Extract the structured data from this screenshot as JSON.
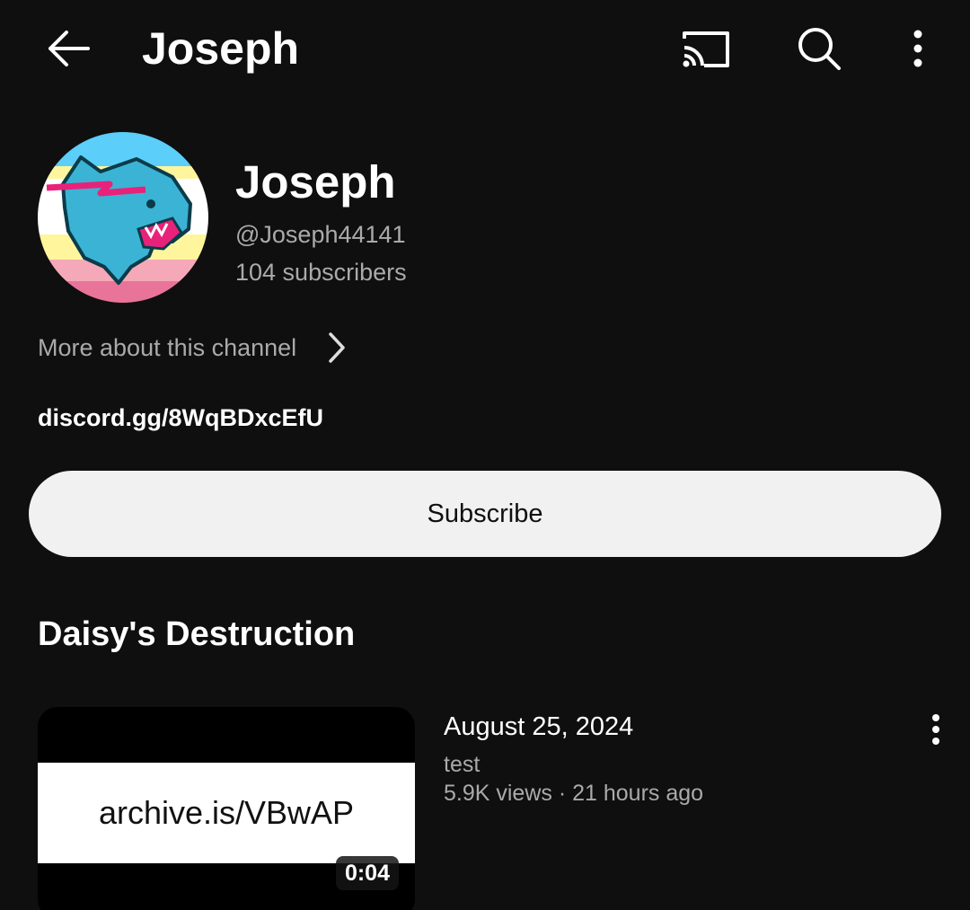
{
  "topbar": {
    "title": "Joseph",
    "icons": [
      "back-arrow-icon",
      "cast-icon",
      "search-icon",
      "more-vert-icon"
    ]
  },
  "channel": {
    "name": "Joseph",
    "handle": "@Joseph44141",
    "subscribers": "104 subscribers",
    "more_about_label": "More about this channel",
    "link": "discord.gg/8WqBDxcEfU",
    "subscribe_label": "Subscribe",
    "avatar_stripes": [
      "#5bcefa",
      "#ffffff",
      "#fff59d",
      "#f5a9b8",
      "#e8749a"
    ]
  },
  "section": {
    "title": "Daisy's Destruction"
  },
  "video": {
    "thumbnail_text": "archive.is/VBwAP",
    "duration": "0:04",
    "title": "August 25, 2024",
    "description": "test",
    "meta": "5.9K views · 21 hours ago"
  },
  "colors": {
    "background": "#0f0f0f",
    "secondary_text": "#aaaaaa",
    "subscribe_bg": "#f1f1f1"
  }
}
